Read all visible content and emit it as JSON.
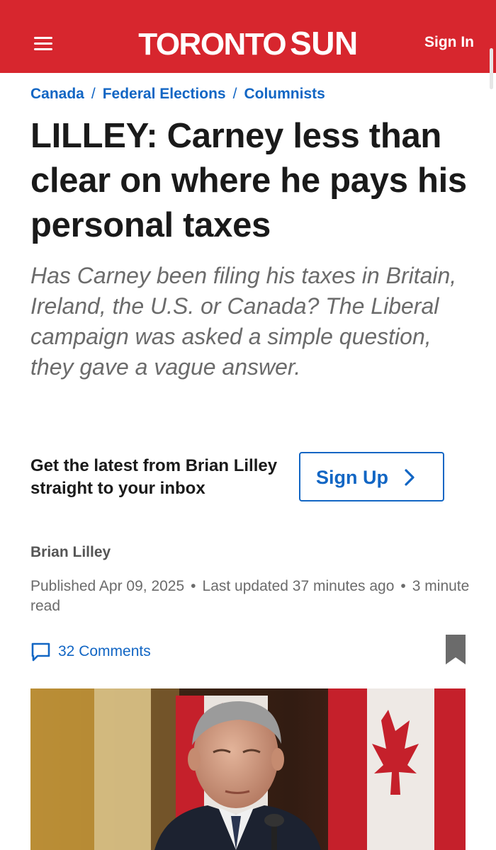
{
  "header": {
    "logo_part1": "TORONTO",
    "logo_part2": "SUN",
    "sign_in": "Sign In",
    "brand_color": "#d7262e"
  },
  "breadcrumb": [
    "Canada",
    "Federal Elections",
    "Columnists"
  ],
  "article": {
    "headline": "LILLEY: Carney less than clear on where he pays his personal taxes",
    "deck": "Has Carney been filing his taxes in Britain, Ireland, the U.S. or Canada? The Liberal campaign was asked a simple question, they gave a vague answer.",
    "author": "Brian Lilley",
    "published": "Published Apr 09, 2025",
    "updated": "Last updated 37 minutes ago",
    "read_time": "3 minute read",
    "comments": "32 Comments"
  },
  "newsletter": {
    "text": "Get the latest from Brian Lilley straight to your inbox",
    "button": "Sign Up"
  },
  "icons": [
    "menu-icon",
    "chevron-right-icon",
    "comment-icon",
    "bookmark-icon"
  ],
  "link_color": "#1266c4"
}
